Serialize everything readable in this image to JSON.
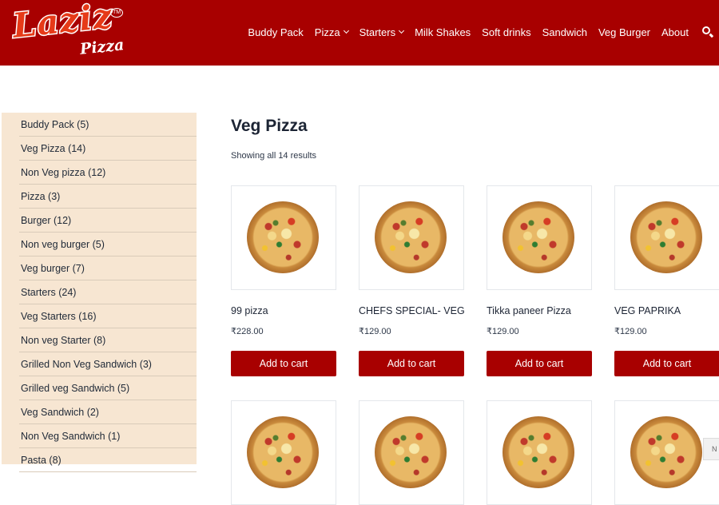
{
  "header": {
    "logo_text": "Laziz",
    "logo_subtext": "Pizza",
    "logo_tm": "TM",
    "nav": [
      {
        "label": "Buddy Pack",
        "dropdown": false
      },
      {
        "label": "Pizza",
        "dropdown": true
      },
      {
        "label": "Starters",
        "dropdown": true
      },
      {
        "label": "Milk Shakes",
        "dropdown": false
      },
      {
        "label": "Soft drinks",
        "dropdown": false
      },
      {
        "label": "Sandwich",
        "dropdown": false
      },
      {
        "label": "Veg Burger",
        "dropdown": false
      },
      {
        "label": "About",
        "dropdown": false
      }
    ],
    "search_icon": "search-icon"
  },
  "sidebar": {
    "categories": [
      "Buddy Pack (5)",
      "Veg Pizza (14)",
      "Non Veg pizza (12)",
      "Pizza (3)",
      "Burger (12)",
      "Non veg burger (5)",
      "Veg burger (7)",
      "Starters (24)",
      "Veg Starters (16)",
      "Non veg Starter (8)",
      "Grilled Non Veg Sandwich (3)",
      "Grilled veg Sandwich (5)",
      "Veg Sandwich (2)",
      "Non Veg Sandwich (1)",
      "Pasta (8)"
    ]
  },
  "main": {
    "title": "Veg Pizza",
    "result_count": "Showing all 14 results",
    "add_to_cart_label": "Add to cart",
    "products": [
      {
        "name": "99 pizza",
        "price": "₹228.00"
      },
      {
        "name": "CHEFS SPECIAL- VEG",
        "price": "₹129.00"
      },
      {
        "name": "Tikka paneer Pizza",
        "price": "₹129.00"
      },
      {
        "name": "VEG PAPRIKA",
        "price": "₹129.00"
      }
    ]
  },
  "corner_tag": "N",
  "colors": {
    "brand_red": "#a80000",
    "sidebar_bg": "#f7e6d2",
    "text_dark": "#1c2434"
  }
}
